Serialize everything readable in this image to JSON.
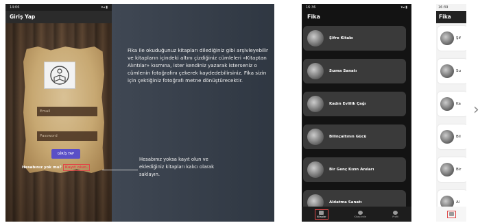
{
  "screen1": {
    "status_time": "14:06",
    "status_right": "▾◂ ▮",
    "title": "Giriş Yap",
    "email_placeholder": "Email",
    "password_placeholder": "Password",
    "login_button": "GİRİŞ YAP",
    "no_account": "Hesabınız yok mu?",
    "signup_link": "Kayıt olun."
  },
  "slide": {
    "description": "Fika ile okuduğunuz kitapları dilediğiniz gibi arşivleyebilir ve kitapların içindeki altını çizdiğiniz cümleleri «Kitaptan Alıntılar» kısmına, ister kendiniz yazarak isterseniz o cümlenin fotoğrafını çekerek kaydedebilirsiniz. Fika sizin için çektiğiniz fotoğrafı metne dönüştürecektir.",
    "note": "Hesabınız yoksa kayıt olun ve eklediğiniz kitapları kalıcı olarak saklayın."
  },
  "screen2": {
    "status_time": "16:36",
    "title": "Fika",
    "books": [
      {
        "title": "Şifre Kitabı"
      },
      {
        "title": "Sızma Sanatı"
      },
      {
        "title": "Kadın Evlilik Çağı"
      },
      {
        "title": "Bilinçaltının Gücü"
      },
      {
        "title": "Bir Genç Kızın Anıları"
      },
      {
        "title": "Aldatma Sanatı"
      }
    ],
    "nav": [
      {
        "label": "Kitaplar"
      },
      {
        "label": "Kitap ekle"
      },
      {
        "label": "Profil"
      }
    ]
  },
  "screen3": {
    "status_time": "16:39",
    "title": "Fika",
    "books": [
      {
        "title": "Şif"
      },
      {
        "title": "Su"
      },
      {
        "title": "Ka"
      },
      {
        "title": "Bil"
      },
      {
        "title": "Bir"
      },
      {
        "title": "Al"
      }
    ]
  },
  "colors": {
    "accent_button": "#5a4fc7",
    "highlight_red": "#e04848"
  }
}
